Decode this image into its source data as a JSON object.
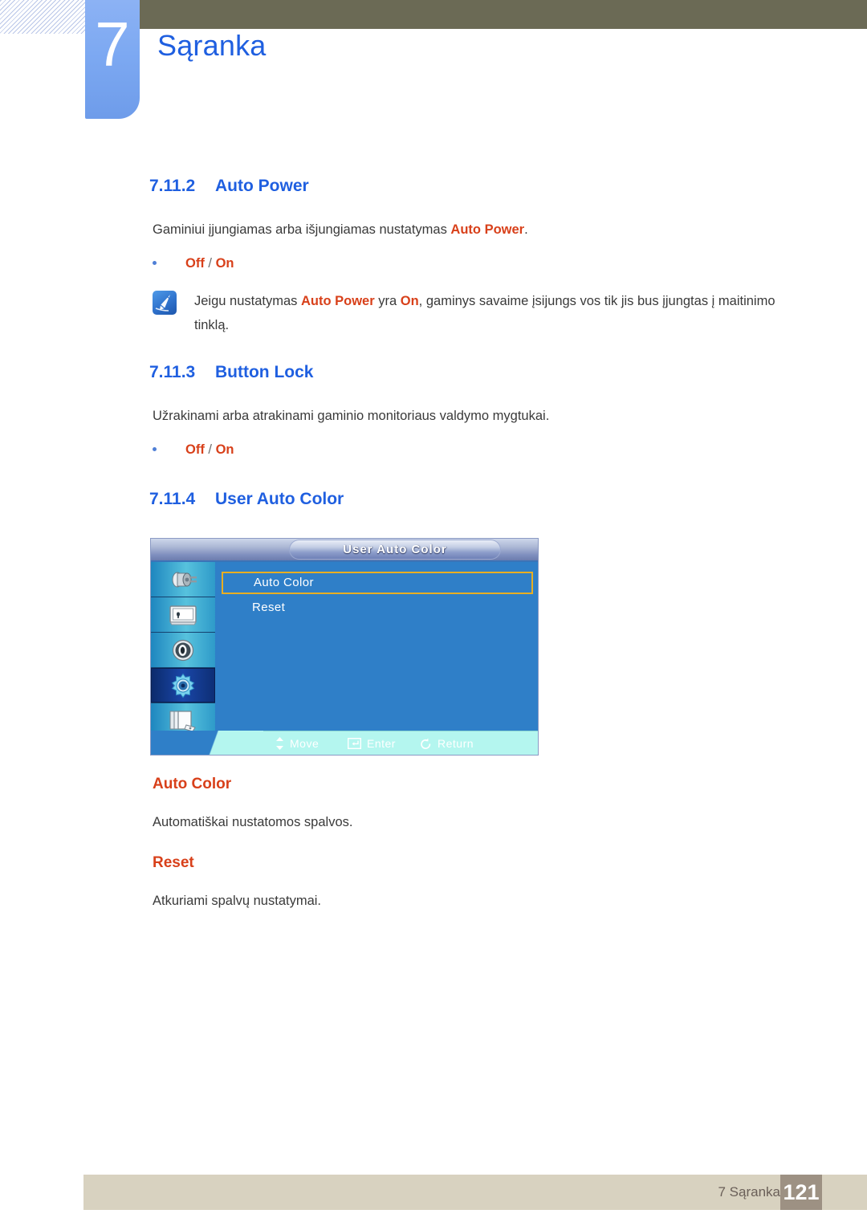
{
  "header": {
    "chapter_number": "7",
    "chapter_title": "Sąranka"
  },
  "sections": [
    {
      "number": "7.11.2",
      "title": "Auto Power",
      "paragraph_pre": "Gaminiui įjungiamas arba išjungiamas nustatymas ",
      "paragraph_em": "Auto Power",
      "paragraph_post": ".",
      "bullet_off": "Off",
      "bullet_sep": " / ",
      "bullet_on": "On"
    },
    {
      "number": "7.11.3",
      "title": "Button Lock",
      "paragraph": "Užrakinami arba atrakinami gaminio monitoriaus valdymo mygtukai.",
      "bullet_off": "Off",
      "bullet_sep": " / ",
      "bullet_on": "On"
    },
    {
      "number": "7.11.4",
      "title": "User Auto Color"
    }
  ],
  "note": {
    "icon": "note-pencil-icon",
    "text_1": "Jeigu nustatymas ",
    "em_1": "Auto Power",
    "text_2": " yra ",
    "em_2": "On",
    "text_3": ", gaminys savaime įsijungs vos tik jis bus įjungtas į maitinimo tinklą."
  },
  "osd": {
    "title": "User Auto Color",
    "sidebar_icons": [
      "input-source-icon",
      "picture-icon",
      "sound-speaker-icon",
      "setup-gear-icon",
      "multi-control-icon"
    ],
    "selected_sidebar_index": 3,
    "items": [
      {
        "label": "Auto Color",
        "highlighted": true
      },
      {
        "label": "Reset",
        "highlighted": false
      }
    ],
    "hints": [
      {
        "icon": "updown-arrow-icon",
        "label": "Move"
      },
      {
        "icon": "enter-key-icon",
        "label": "Enter"
      },
      {
        "icon": "return-arrow-icon",
        "label": "Return"
      }
    ],
    "colors": {
      "body": "#2f7fc8",
      "highlight_border": "#e8ae22",
      "bottom_bar": "#b4f6ef"
    }
  },
  "descriptions": [
    {
      "heading": "Auto Color",
      "body": "Automatiškai nustatomos spalvos."
    },
    {
      "heading": "Reset",
      "body": "Atkuriami spalvų nustatymai."
    }
  ],
  "footer": {
    "label": "7 Sąranka",
    "page_number": "121"
  }
}
